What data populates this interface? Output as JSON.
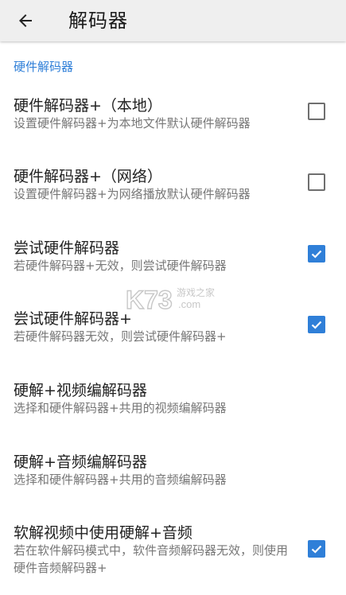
{
  "appbar": {
    "title": "解码器",
    "back_icon": "arrow-back-icon"
  },
  "category": {
    "label": "硬件解码器"
  },
  "prefs": [
    {
      "title": "硬件解码器+（本地）",
      "summary": "设置硬件解码器+为本地文件默认硬件解码器",
      "checked": false
    },
    {
      "title": "硬件解码器+（网络）",
      "summary": "设置硬件解码器+为网络播放默认硬件解码器",
      "checked": false
    },
    {
      "title": "尝试硬件解码器",
      "summary": "若硬件解码器+无效，则尝试硬件解码器",
      "checked": true
    },
    {
      "title": "尝试硬件解码器+",
      "summary": "若硬件解码器无效，则尝试硬件解码器+",
      "checked": true
    },
    {
      "title": "硬解+视频编解码器",
      "summary": "选择和硬件解码器+共用的视频编解码器"
    },
    {
      "title": "硬解+音频编解码器",
      "summary": "选择和硬件解码器+共用的音频编解码器"
    },
    {
      "title": "软解视频中使用硬解+音频",
      "summary": "若在软件解码模式中，软件音频解码器无效，则使用硬件音频解码器+",
      "checked": true
    }
  ],
  "watermark": {
    "brand": "K73",
    "tagline": "游戏之家",
    "domain": ".com"
  },
  "colors": {
    "accent": "#2f7fd8",
    "appbar_bg": "#efefef"
  }
}
